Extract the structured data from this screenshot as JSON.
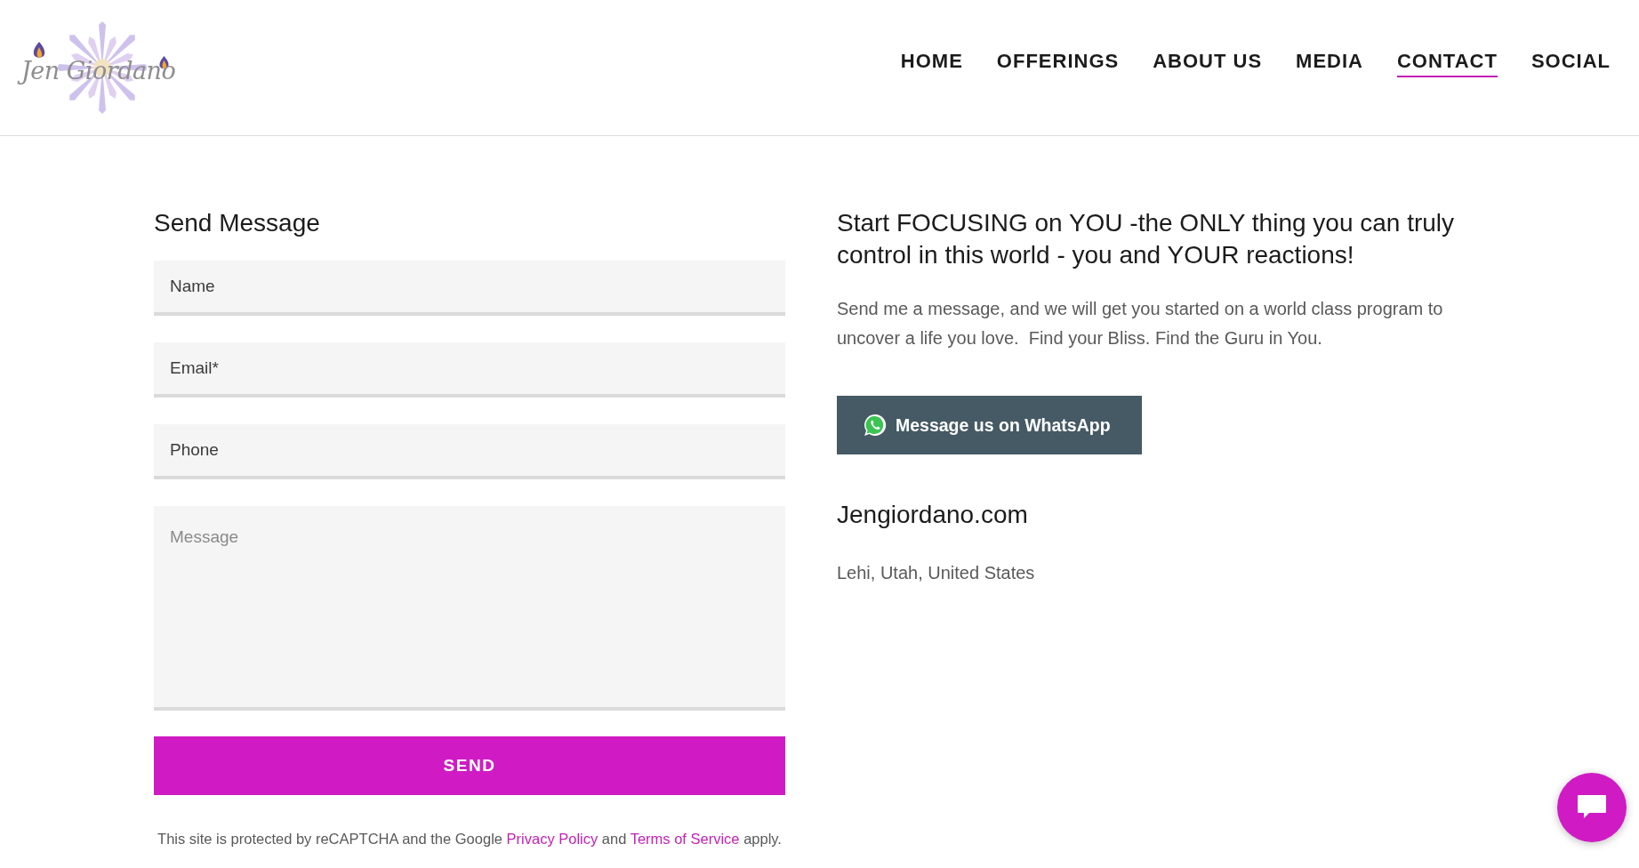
{
  "header": {
    "logo_text": "Jen Giordano",
    "nav": [
      {
        "label": "HOME",
        "selected": false
      },
      {
        "label": "OFFERINGS",
        "selected": false
      },
      {
        "label": "ABOUT US",
        "selected": false
      },
      {
        "label": "MEDIA",
        "selected": false
      },
      {
        "label": "CONTACT",
        "selected": true
      },
      {
        "label": "SOCIAL",
        "selected": false
      }
    ]
  },
  "form": {
    "title": "Send Message",
    "fields": [
      {
        "kind": "input",
        "placeholder": "Name"
      },
      {
        "kind": "input",
        "placeholder": "Email*"
      },
      {
        "kind": "input",
        "placeholder": "Phone"
      },
      {
        "kind": "textarea",
        "placeholder": "Message"
      }
    ],
    "submit": "SEND",
    "notice": [
      {
        "kind": "text",
        "text": "This site is protected by reCAPTCHA and the Google "
      },
      {
        "kind": "link",
        "text": "Privacy Policy"
      },
      {
        "kind": "text",
        "text": " and "
      },
      {
        "kind": "link",
        "text": "Terms of Service"
      },
      {
        "kind": "text",
        "text": " apply."
      }
    ]
  },
  "info": {
    "heading": "Start FOCUSING on YOU -the ONLY thing you can truly control in this world - you and YOUR reactions!",
    "paragraph": "Send me a message, and we will get you started on a world class program to uncover a life you love.  Find your Bliss. Find the Guru in You.",
    "whatsapp_button": "Message us on WhatsApp",
    "site": "Jengiordano.com",
    "location": "Lehi, Utah, United States"
  }
}
